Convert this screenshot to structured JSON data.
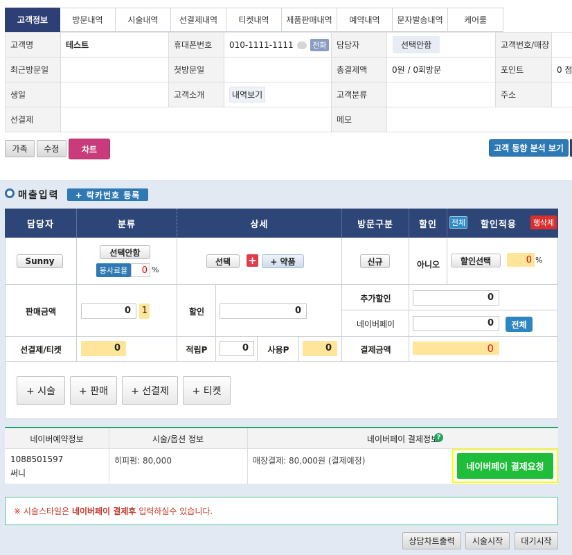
{
  "tabs": [
    "고객정보",
    "방문내역",
    "시술내역",
    "선결제내역",
    "티켓내역",
    "제품판매내역",
    "예약내역",
    "문자발송내역",
    "케어룰"
  ],
  "customer": {
    "name_label": "고객명",
    "name": "테스트",
    "phone_label": "휴대폰번호",
    "phone": "010-1111-1111",
    "call_label": "전화",
    "manager_label": "담당자",
    "manager_value": "선택안함",
    "custno_label": "고객번호/매장",
    "lastvisit_label": "최근방문일",
    "firstvisit_label": "첫방문일",
    "totalpay_label": "총결제액",
    "totalpay": "0원 / 0회방문",
    "point_label": "포인트",
    "point": "0 점",
    "birthday_label": "생일",
    "intro_label": "고객소개",
    "intro_btn": "내역보기",
    "category_label": "고객분류",
    "address_label": "주소",
    "prepay_label": "선결제",
    "memo_label": "메모"
  },
  "actions": {
    "family": "가족",
    "edit": "수정",
    "chart": "차트",
    "analysis": "고객 동향 분석 보기"
  },
  "sales": {
    "title": "매출입력",
    "locker_btn": "+ 락카번호 등록",
    "headers": {
      "manager": "담당자",
      "category": "분류",
      "detail": "상세",
      "visit": "방문구분",
      "discount": "할인",
      "all": "전체",
      "apply": "할인적용",
      "delete": "행삭제"
    },
    "row": {
      "manager": "Sunny",
      "category": "선택안함",
      "service_rate_label": "봉사료율",
      "service_rate": "0",
      "pct": "%",
      "select": "선택",
      "plus": "+",
      "drug": "+ 약품",
      "visit": "신규",
      "discount": "아니오",
      "discount_select": "할인선택",
      "discount_value": "0",
      "discount_pct": "%"
    },
    "sale_amount_label": "판매금액",
    "sale_amount": "0",
    "sale_qty": "1",
    "discount_label": "할인",
    "discount_amount": "0",
    "extra_discount_label": "추가할인",
    "extra_discount": "0",
    "naverpay_label": "네이버페이",
    "naverpay": "0",
    "naverpay_all": "전체",
    "prepay_ticket_label": "선결제/티켓",
    "prepay_ticket": "0",
    "earn_label": "적립P",
    "earn": "0",
    "use_label": "사용P",
    "use": "0",
    "pay_label": "결제금액",
    "pay": "0",
    "add_buttons": [
      "+ 시술",
      "+ 판매",
      "+ 선결제",
      "+ 티켓"
    ]
  },
  "naver": {
    "col1": "네이버예약정보",
    "col2": "시술/옵션 정보",
    "col3": "네이버페이 결제정보",
    "booking_no": "1088501597",
    "booking_name": "써니",
    "option": "히피펌: 80,000",
    "payment": "매장결제: 80,000원 (결제예정)",
    "request_btn": "네이버페이 결제요청"
  },
  "notice": {
    "prefix": "※ 시술스타일은 ",
    "bold": "네이버페이 결제후",
    "suffix": " 입력하실수 있습니다."
  },
  "footer": {
    "consult": "상담차트출력",
    "start": "시술시작",
    "wait": "대기시작"
  }
}
